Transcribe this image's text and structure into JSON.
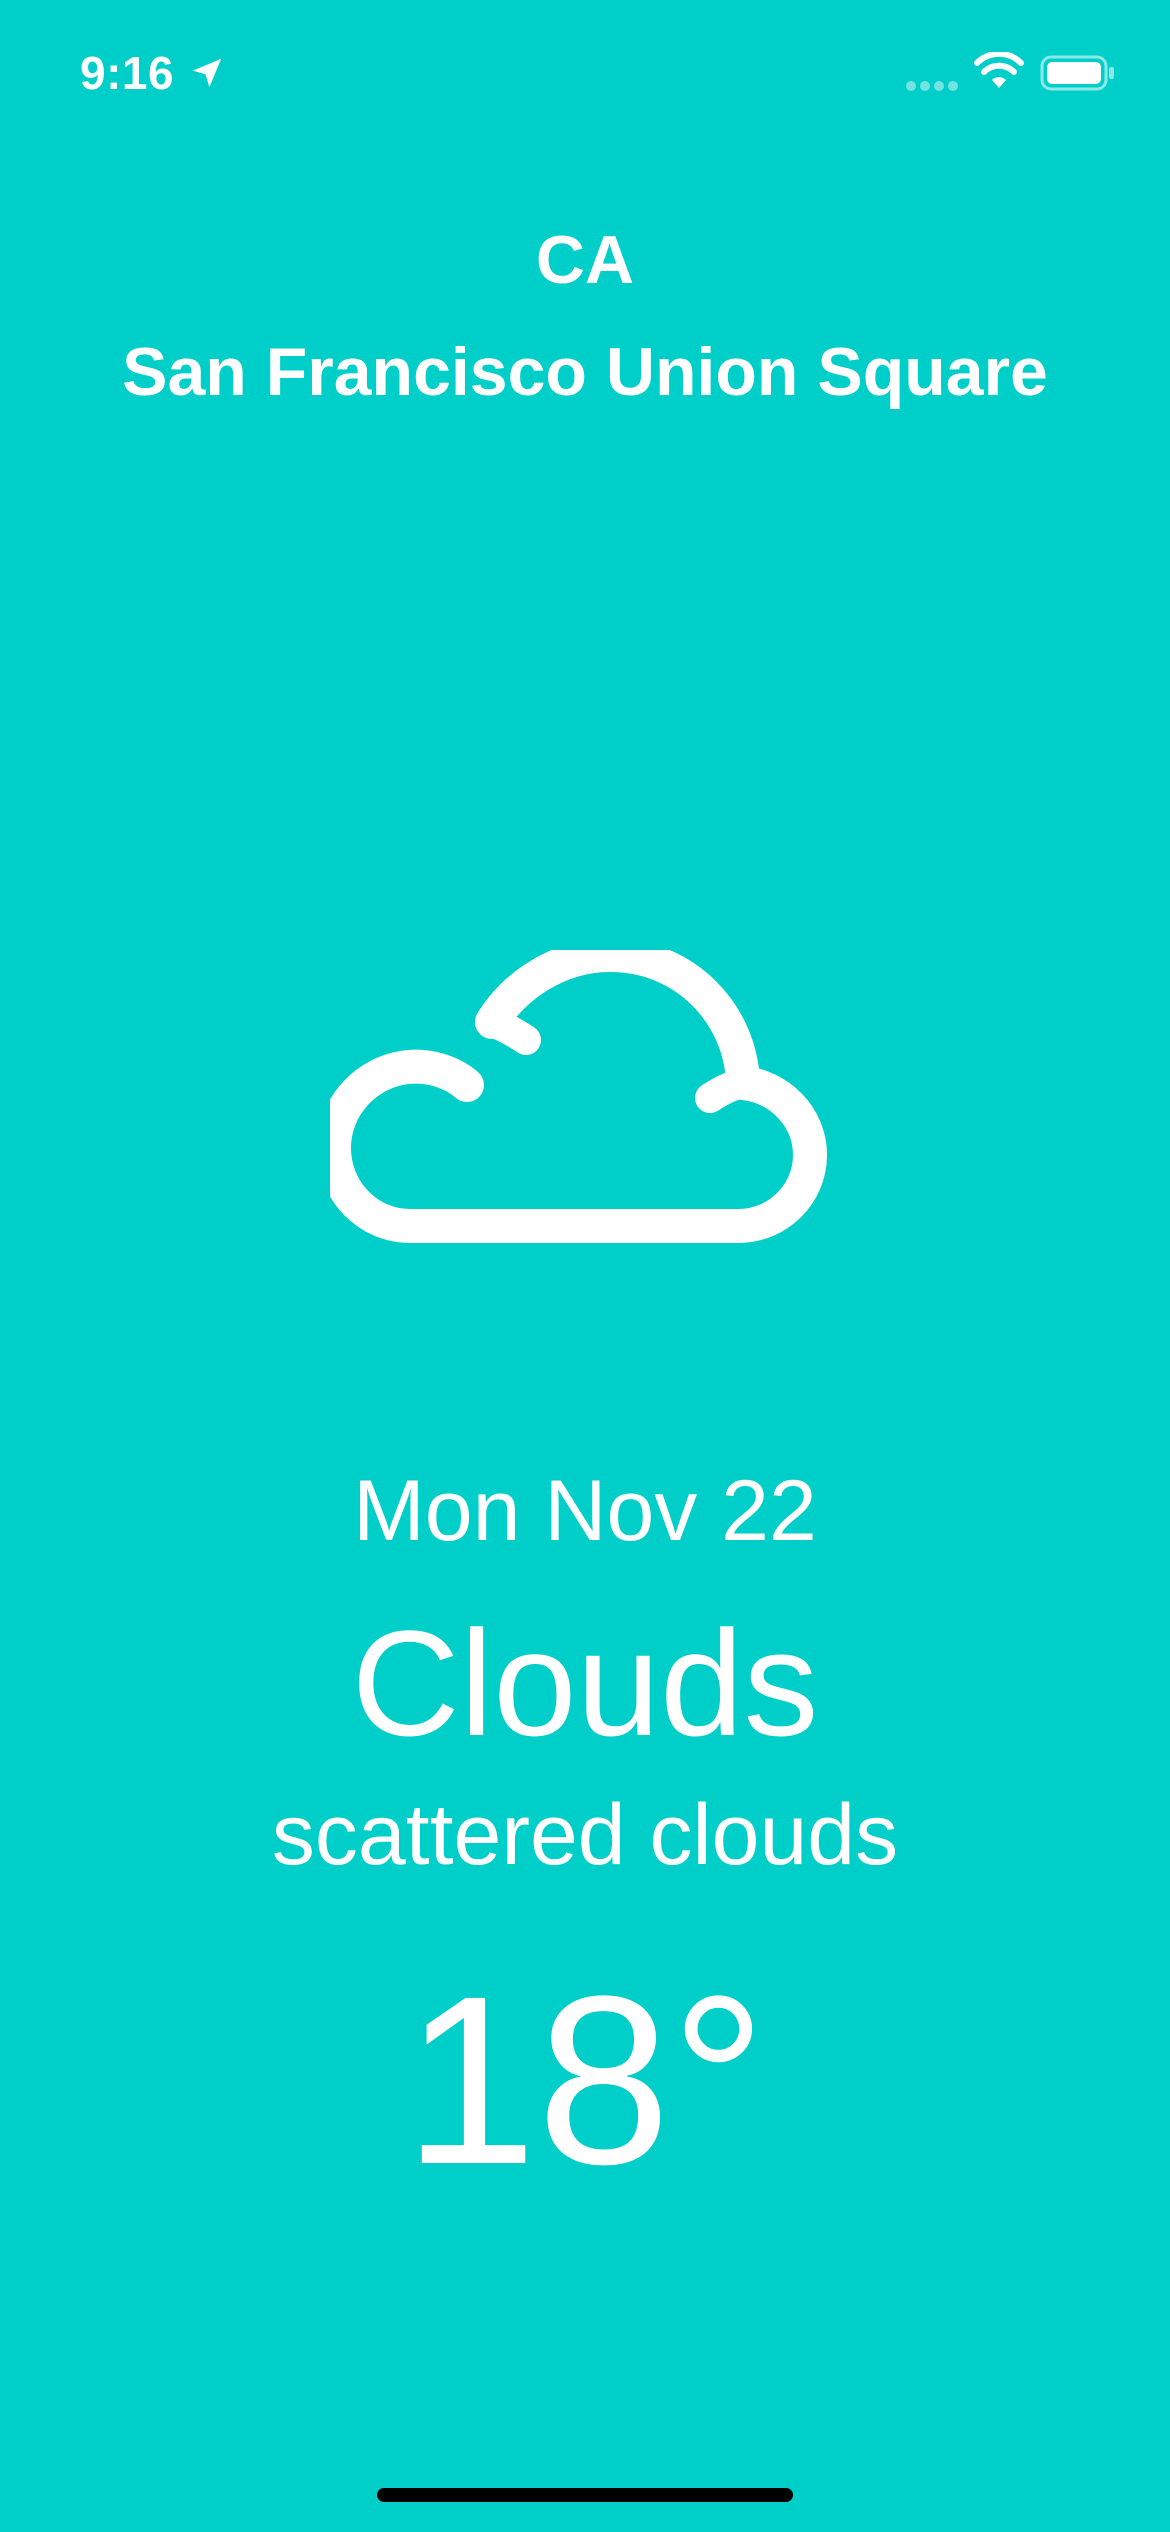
{
  "status_bar": {
    "time": "9:16",
    "icons": [
      "location-arrow-icon",
      "cellular-signal-icon",
      "wifi-icon",
      "battery-icon"
    ]
  },
  "location": {
    "region": "CA",
    "city": "San Francisco Union Square"
  },
  "weather": {
    "icon": "cloud-icon",
    "date": "Mon Nov 22",
    "condition": "Clouds",
    "description": "scattered clouds",
    "temperature": "18°"
  },
  "colors": {
    "background": "#00CEC9",
    "foreground": "#FFFFFF",
    "home_indicator": "#000000"
  }
}
